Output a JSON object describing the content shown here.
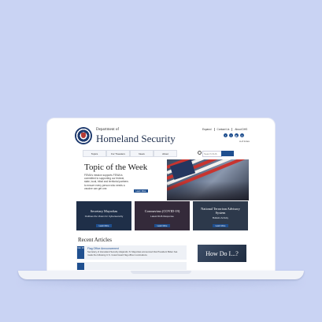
{
  "header": {
    "dept_small": "Department of",
    "dept_big": "Homeland Security",
    "util_links": [
      "Espanol",
      "Contact Us",
      "About DHS"
    ],
    "social_icons": [
      "facebook-icon",
      "twitter-icon",
      "youtube-icon",
      "linkedin-icon"
    ],
    "flag_text": "A-Z Index"
  },
  "nav": {
    "items": [
      "Topics",
      "For Travelers",
      "News",
      "About"
    ],
    "search_placeholder": "Search DHS"
  },
  "hero": {
    "title": "Topic of the Week",
    "text": "FEMA's mission supports FEMA is committed to supporting our federal, state, local, tribal and territorial partners to ensure every person who needs a vaccine can get one.",
    "button": "Learn More"
  },
  "cards": [
    {
      "title": "Secretary Mayorkas",
      "subtitle": "Outlines the Vision for Cybersecurity",
      "button": "Learn More",
      "color": "#2d4565"
    },
    {
      "title": "Coronavirus (COVID-19)",
      "subtitle": "Latest DHS Response",
      "button": "Learn More",
      "color": "#5b3a45"
    },
    {
      "title": "National Terrorism Advisory System",
      "subtitle": "Bulletin Activity",
      "button": "Learn More",
      "color": "#4d5c6c"
    }
  ],
  "recent": {
    "title": "Recent Articles",
    "article": {
      "date": "Mar 18",
      "title": "Flag Office Announcement",
      "text": "Secretary of Homeland Security Alejandro N. Mayorkas announced that President Biden has made the following U.S. Coast Guard flag officer nominations."
    },
    "howdo": "How Do I...?"
  }
}
